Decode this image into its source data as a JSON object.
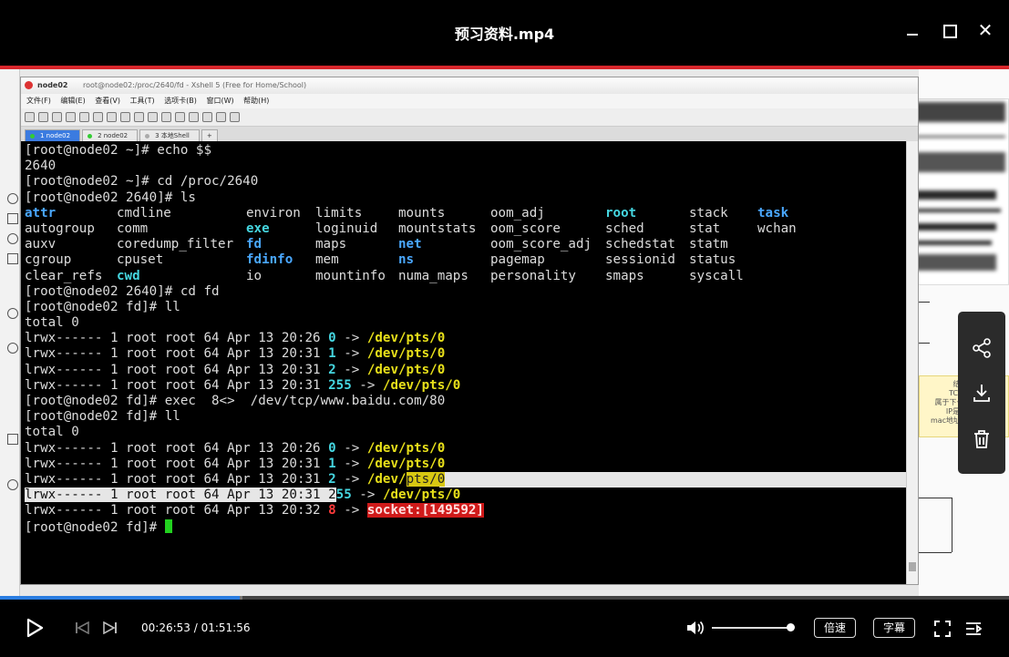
{
  "window": {
    "title": "预习资料.mp4",
    "minimize_icon": "minimize-icon",
    "maximize_icon": "maximize-icon",
    "close_icon": "close-icon",
    "close_glyph": "✕"
  },
  "xshell": {
    "session_name": "node02",
    "title_path": "root@node02:/proc/2640/fd - Xshell 5 (Free for Home/School)",
    "menu": [
      "文件(F)",
      "编辑(E)",
      "查看(V)",
      "工具(T)",
      "选项卡(B)",
      "窗口(W)",
      "帮助(H)"
    ],
    "tabs": [
      {
        "label": "1 node02",
        "active": true
      },
      {
        "label": "2 node02",
        "active": false
      },
      {
        "label": "3 本地Shell",
        "active": false
      }
    ],
    "add_tab_label": "+"
  },
  "terminal": {
    "lines": [
      "[root@node02 ~]# echo $$",
      "2640",
      "[root@node02 ~]# cd /proc/2640",
      "[root@node02 2640]# ls"
    ],
    "ls_columns": [
      [
        {
          "t": "attr",
          "c": "blue"
        },
        {
          "t": "autogroup"
        },
        {
          "t": "auxv"
        },
        {
          "t": "cgroup"
        },
        {
          "t": "clear_refs"
        }
      ],
      [
        {
          "t": "cmdline"
        },
        {
          "t": "comm"
        },
        {
          "t": "coredump_filter"
        },
        {
          "t": "cpuset"
        },
        {
          "t": "cwd",
          "c": "cyan"
        }
      ],
      [
        {
          "t": "environ"
        },
        {
          "t": "exe",
          "c": "cyan"
        },
        {
          "t": "fd",
          "c": "blue"
        },
        {
          "t": "fdinfo",
          "c": "blue"
        },
        {
          "t": "io"
        }
      ],
      [
        {
          "t": "limits"
        },
        {
          "t": "loginuid"
        },
        {
          "t": "maps"
        },
        {
          "t": "mem"
        },
        {
          "t": "mountinfo"
        }
      ],
      [
        {
          "t": "mounts"
        },
        {
          "t": "mountstats"
        },
        {
          "t": "net",
          "c": "blue"
        },
        {
          "t": "ns",
          "c": "blue"
        },
        {
          "t": "numa_maps"
        }
      ],
      [
        {
          "t": "oom_adj"
        },
        {
          "t": "oom_score"
        },
        {
          "t": "oom_score_adj"
        },
        {
          "t": "pagemap"
        },
        {
          "t": "personality"
        }
      ],
      [
        {
          "t": "root",
          "c": "cyan"
        },
        {
          "t": "sched"
        },
        {
          "t": "schedstat"
        },
        {
          "t": "sessionid"
        },
        {
          "t": "smaps"
        }
      ],
      [
        {
          "t": "stack"
        },
        {
          "t": "stat"
        },
        {
          "t": "statm"
        },
        {
          "t": "status"
        },
        {
          "t": "syscall"
        }
      ],
      [
        {
          "t": "task",
          "c": "blue"
        },
        {
          "t": "wchan"
        },
        {
          "t": ""
        },
        {
          "t": ""
        },
        {
          "t": ""
        }
      ]
    ],
    "after_ls": [
      "[root@node02 2640]# cd fd",
      "[root@node02 fd]# ll",
      "total 0"
    ],
    "fd_list_1": [
      {
        "perm": "lrwx------ 1 root root 64 Apr 13 20:26 ",
        "fd": "0",
        "arrow": " -> ",
        "target": "/dev/pts/0"
      },
      {
        "perm": "lrwx------ 1 root root 64 Apr 13 20:31 ",
        "fd": "1",
        "arrow": " -> ",
        "target": "/dev/pts/0"
      },
      {
        "perm": "lrwx------ 1 root root 64 Apr 13 20:31 ",
        "fd": "2",
        "arrow": " -> ",
        "target": "/dev/pts/0"
      },
      {
        "perm": "lrwx------ 1 root root 64 Apr 13 20:31 ",
        "fd": "255",
        "arrow": " -> ",
        "target": "/dev/pts/0"
      }
    ],
    "exec_cmd": "[root@node02 fd]# exec  8<>  /dev/tcp/www.baidu.com/80",
    "ll_cmd": "[root@node02 fd]# ll",
    "total": "total 0",
    "fd_list_2": [
      {
        "perm": "lrwx------ 1 root root 64 Apr 13 20:26 ",
        "fd": "0",
        "arrow": " -> ",
        "target": "/dev/pts/0"
      },
      {
        "perm": "lrwx------ 1 root root 64 Apr 13 20:31 ",
        "fd": "1",
        "arrow": " -> ",
        "target": "/dev/pts/0"
      },
      {
        "perm": "lrwx------ 1 root root 64 Apr 13 20:31 ",
        "fd": "2",
        "arrow": " -> ",
        "target": "/dev/pts/0"
      },
      {
        "perm": "lrwx------ 1 root root 64 Apr 13 20:31 ",
        "fd": "255",
        "arrow": " -> ",
        "target": "/dev/pts/0"
      },
      {
        "perm": "lrwx------ 1 root root 64 Apr 13 20:32 ",
        "fd": "8",
        "arrow": " -> ",
        "target": "socket:[149592]"
      }
    ],
    "prompt": "[root@node02 fd]# "
  },
  "background_note": {
    "lines": [
      "结论：",
      "TCP/IP协",
      "属于下一跳的机制",
      "IP是端点间",
      "mac地址是节点间的"
    ]
  },
  "side_panel": {
    "share_icon": "share-icon",
    "download_icon": "download-icon",
    "delete_icon": "trash-icon"
  },
  "player": {
    "progress_fraction": 0.238,
    "buffered_fraction": 0.24,
    "current_time": "00:26:53",
    "separator": " / ",
    "duration": "01:51:56",
    "volume_fraction": 1.0,
    "speed_label": "倍速",
    "subtitle_label": "字幕",
    "play_icon": "play-icon",
    "prev_icon": "skip-previous-icon",
    "next_icon": "skip-next-icon",
    "volume_icon": "volume-icon",
    "fullscreen_icon": "fullscreen-icon",
    "playlist_icon": "playlist-icon",
    "accent_color": "#2a7de1"
  }
}
